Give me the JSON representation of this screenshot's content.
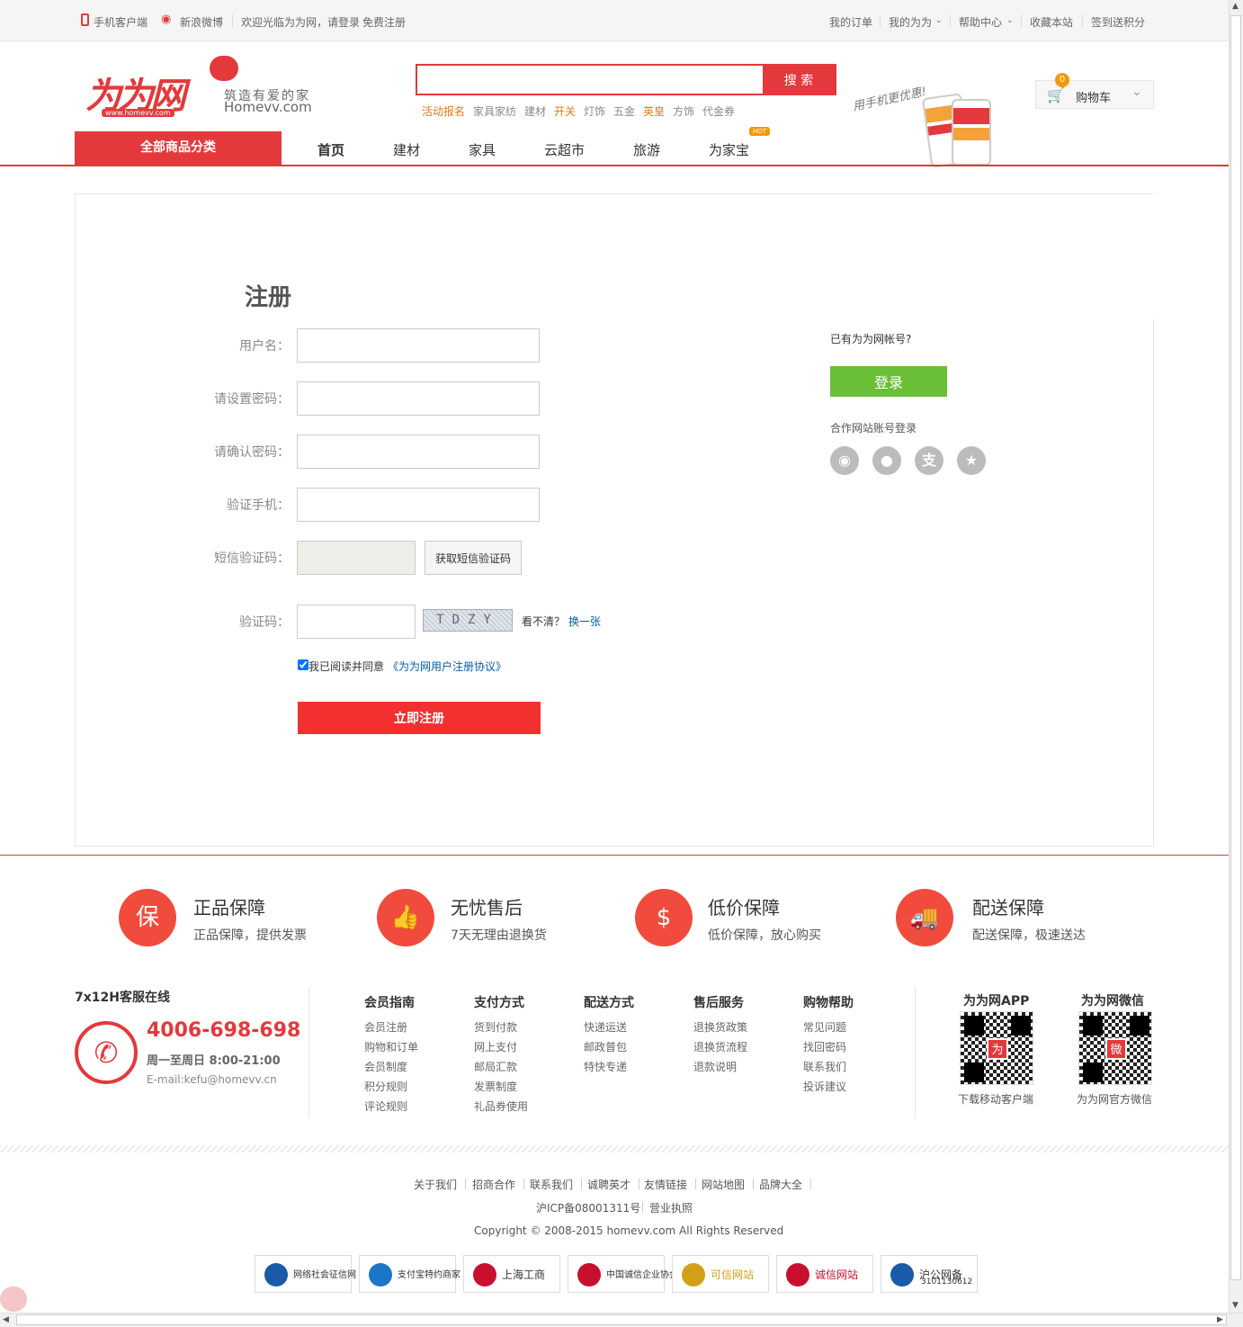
{
  "topbar": {
    "mobile": "手机客户端",
    "weibo": "新浪微博",
    "welcome": "欢迎光临为为网，请",
    "login": "登录",
    "register": "免费注册",
    "orders": "我的订单",
    "my": "我的为为",
    "help": "帮助中心",
    "favorite": "收藏本站",
    "signin": "签到送积分"
  },
  "logo": {
    "mark": "为为网",
    "url": "www.homevv.com",
    "slogan": "筑造有爱的家",
    "domain": "Homevv.com"
  },
  "search": {
    "button": "搜 索",
    "placeholder": "",
    "hotwords": [
      "活动报名",
      "家具家纺",
      "建材",
      "开关",
      "灯饰",
      "五金",
      "英皇",
      "方饰",
      "代金券"
    ]
  },
  "promo": {
    "text": "用手机更优惠!"
  },
  "cart": {
    "count": "0",
    "label": "购物车"
  },
  "nav": {
    "all": "全部商品分类",
    "items": [
      "首页",
      "建材",
      "家具",
      "云超市",
      "旅游",
      "为家宝"
    ],
    "hot": "HOT"
  },
  "register": {
    "title": "注册",
    "username": "用户名：",
    "password": "请设置密码：",
    "confirm": "请确认密码：",
    "phone": "验证手机：",
    "sms": "短信验证码：",
    "sms_button": "获取短信验证码",
    "captcha": "验证码：",
    "captcha_text": "TDZY",
    "unclear": "看不清？",
    "refresh": "换一张",
    "agree": "我已阅读并同意",
    "agreement": "《为为网用户注册协议》",
    "submit": "立即注册"
  },
  "side": {
    "has_account": "已有为为网帐号?",
    "login": "登录",
    "partner": "合作网站账号登录",
    "social": [
      {
        "name": "weibo-icon",
        "glyph": "◉"
      },
      {
        "name": "qq-icon",
        "glyph": "●"
      },
      {
        "name": "alipay-icon",
        "glyph": "支"
      },
      {
        "name": "favorite-icon",
        "glyph": "★"
      }
    ]
  },
  "guarantees": [
    {
      "title": "正品保障",
      "sub": "正品保障，提供发票",
      "glyph": "保"
    },
    {
      "title": "无忧售后",
      "sub": "7天无理由退换货",
      "glyph": "👍"
    },
    {
      "title": "低价保障",
      "sub": "低价保障，放心购买",
      "glyph": "$"
    },
    {
      "title": "配送保障",
      "sub": "配送保障，极速送达",
      "glyph": "🚚"
    }
  ],
  "service": {
    "title": "7x12H客服在线",
    "phone": "4006-698-698",
    "hours": "周一至周日 8:00-21:00",
    "email": "E-mail:kefu@homevv.cn"
  },
  "footer_cols": [
    {
      "title": "会员指南",
      "items": [
        "会员注册",
        "购物和订单",
        "会员制度",
        "积分规则",
        "评论规则"
      ]
    },
    {
      "title": "支付方式",
      "items": [
        "货到付款",
        "网上支付",
        "邮局汇款",
        "发票制度",
        "礼品券使用"
      ]
    },
    {
      "title": "配送方式",
      "items": [
        "快递运送",
        "邮政普包",
        "特快专递"
      ]
    },
    {
      "title": "售后服务",
      "items": [
        "退换货政策",
        "退换货流程",
        "退款说明"
      ]
    },
    {
      "title": "购物帮助",
      "items": [
        "常见问题",
        "找回密码",
        "联系我们",
        "投诉建议"
      ]
    }
  ],
  "qrcodes": [
    {
      "title": "为为网APP",
      "caption": "下载移动客户端",
      "center": "为"
    },
    {
      "title": "为为网微信",
      "caption": "为为网官方微信",
      "center": "微"
    }
  ],
  "bottom_links": [
    "关于我们",
    "招商合作",
    "联系我们",
    "诚聘英才",
    "友情链接",
    "网站地图",
    "品牌大全"
  ],
  "icp": "沪ICP备08001311号",
  "license": "营业执照",
  "copyright": "Copyright © 2008-2015 homevv.com All Rights Reserved",
  "badges": [
    {
      "label": "网络社会征信网",
      "color": "#1a5aa8"
    },
    {
      "label": "支付宝特约商家",
      "color": "#1b76c8"
    },
    {
      "label": "上海工商",
      "color": "#c8102e"
    },
    {
      "label": "中国诚信企业协会",
      "color": "#c8102e"
    },
    {
      "label": "可信网站",
      "color": "#d4a017"
    },
    {
      "label": "诚信网站",
      "color": "#c8102e"
    },
    {
      "label": "沪公网备",
      "color": "#1a5aa8"
    }
  ],
  "badge_sub": "3101130612",
  "colors": {
    "brand": "#e4393c",
    "login": "#6abf37",
    "accent": "#f04b3c"
  }
}
